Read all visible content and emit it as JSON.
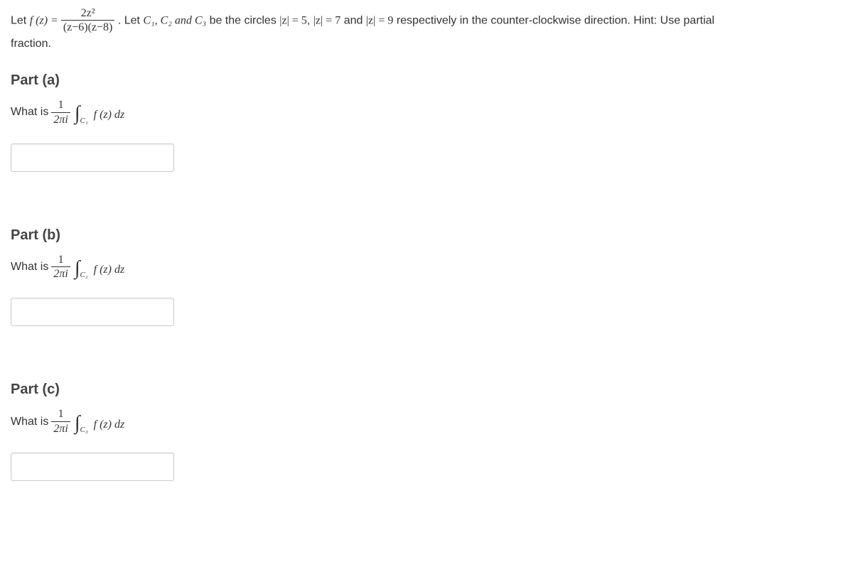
{
  "intro": {
    "let_fz": "Let ",
    "fz_equals": "f (z) = ",
    "frac_num": "2z²",
    "frac_den": "(z−6)(z−8)",
    "let_circles": ". Let ",
    "c1c2c3": "C₁, C₂ and C₃",
    "be_circles": " be the circles ",
    "z_eq_5": "|z| = 5",
    "comma1": ", ",
    "z_eq_7": "|z| = 7",
    "and_text": " and ",
    "z_eq_9": "|z| = 9",
    "respectively": " respectively in the counter-clockwise direction. Hint: Use partial",
    "fraction_line": "fraction."
  },
  "parts": {
    "a": {
      "heading": "Part (a)",
      "whatis": "What is ",
      "frac_num": "1",
      "frac_den": "2πi",
      "integral_sub": "C₁",
      "integrand": "f (z) dz"
    },
    "b": {
      "heading": "Part (b)",
      "whatis": "What is ",
      "frac_num": "1",
      "frac_den": "2πi",
      "integral_sub": "C₂",
      "integrand": "f (z) dz"
    },
    "c": {
      "heading": "Part (c)",
      "whatis": "What is ",
      "frac_num": "1",
      "frac_den": "2πi",
      "integral_sub": "C₃",
      "integrand": "f (z) dz"
    }
  }
}
